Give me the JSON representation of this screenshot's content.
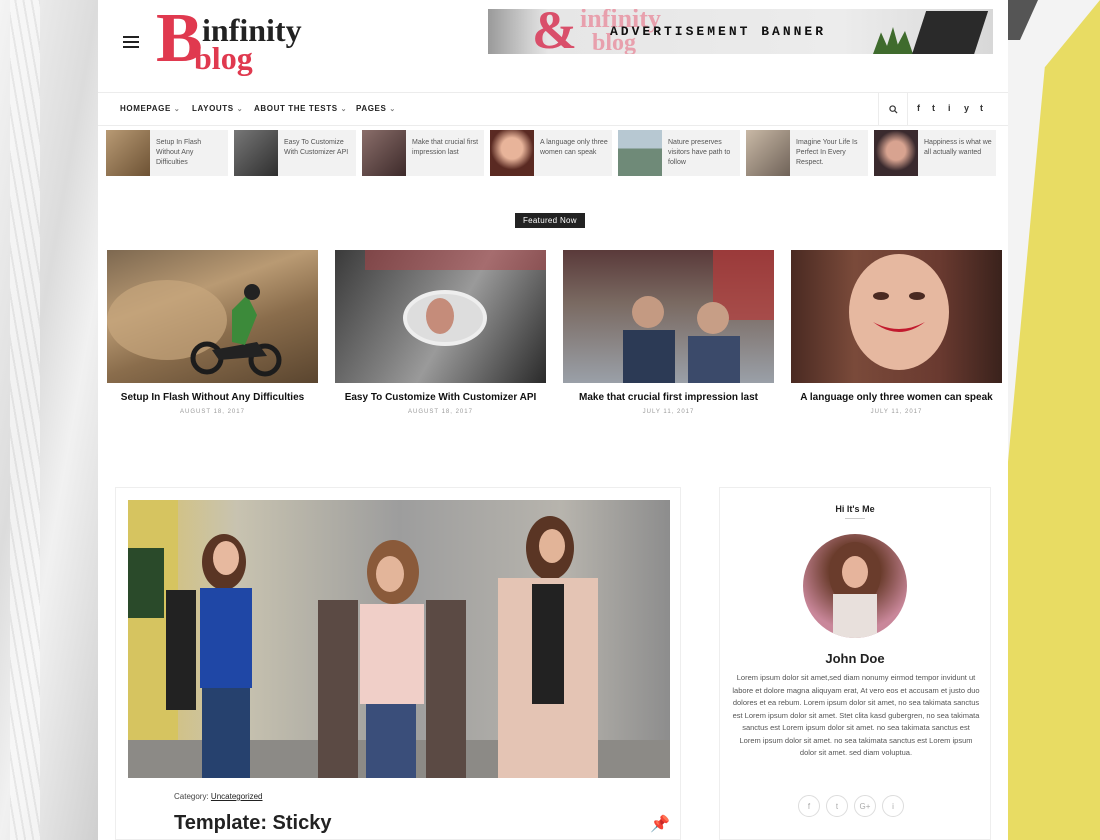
{
  "logo": {
    "b": "B",
    "line1": "infinity",
    "line2": "blog"
  },
  "ad": {
    "text": "ADVERTISEMENT BANNER",
    "ampersand": "&",
    "ghost1": "infinity",
    "ghost2": "blog"
  },
  "nav": {
    "items": [
      {
        "label": "HOMEPAGE"
      },
      {
        "label": "LAYOUTS"
      },
      {
        "label": "ABOUT THE TESTS"
      },
      {
        "label": "PAGES"
      }
    ],
    "social": [
      "f",
      "t",
      "i",
      "y",
      "t"
    ]
  },
  "ticker": [
    {
      "title": "Setup In Flash Without Any Difficulties",
      "color": "#8c6a44"
    },
    {
      "title": "Easy To Customize With Customizer API",
      "color": "#5a5a5a"
    },
    {
      "title": "Make that crucial first impression last",
      "color": "#6a4a48"
    },
    {
      "title": "A language only three women can speak",
      "color": "#7c3d38"
    },
    {
      "title": "Nature preserves visitors have path to follow",
      "color": "#5f7a6a"
    },
    {
      "title": "Imagine Your Life Is Perfect In Every Respect.",
      "color": "#8a7d72"
    },
    {
      "title": "Happiness is what we all actually wanted",
      "color": "#5a3a40"
    }
  ],
  "featured": {
    "label": "Featured Now",
    "cards": [
      {
        "title": "Setup In Flash Without Any Difficulties",
        "date": "AUGUST 18, 2017"
      },
      {
        "title": "Easy To Customize With Customizer API",
        "date": "AUGUST 18, 2017"
      },
      {
        "title": "Make that crucial first impression last",
        "date": "JULY 11, 2017"
      },
      {
        "title": "A language only three women can speak",
        "date": "JULY 11, 2017"
      }
    ]
  },
  "post": {
    "category_label": "Category:",
    "category": "Uncategorized",
    "title": "Template: Sticky"
  },
  "sidebar": {
    "heading": "Hi It's Me",
    "name": "John Doe",
    "bio": "Lorem ipsum dolor sit amet,sed diam nonumy eirmod tempor invidunt ut labore et dolore magna aliquyam erat, At vero eos et accusam et justo duo dolores et ea rebum. Lorem ipsum dolor sit amet, no sea takimata sanctus est Lorem ipsum dolor sit amet. Stet clita kasd gubergren, no sea takimata sanctus est Lorem ipsum dolor sit amet. no sea takimata sanctus est Lorem ipsum dolor sit amet. no sea takimata sanctus est Lorem ipsum dolor sit amet. sed diam voluptua.",
    "socials": [
      "f",
      "t",
      "G+",
      "i"
    ]
  },
  "colors": {
    "brand": "#e0394f",
    "dark": "#222222"
  }
}
